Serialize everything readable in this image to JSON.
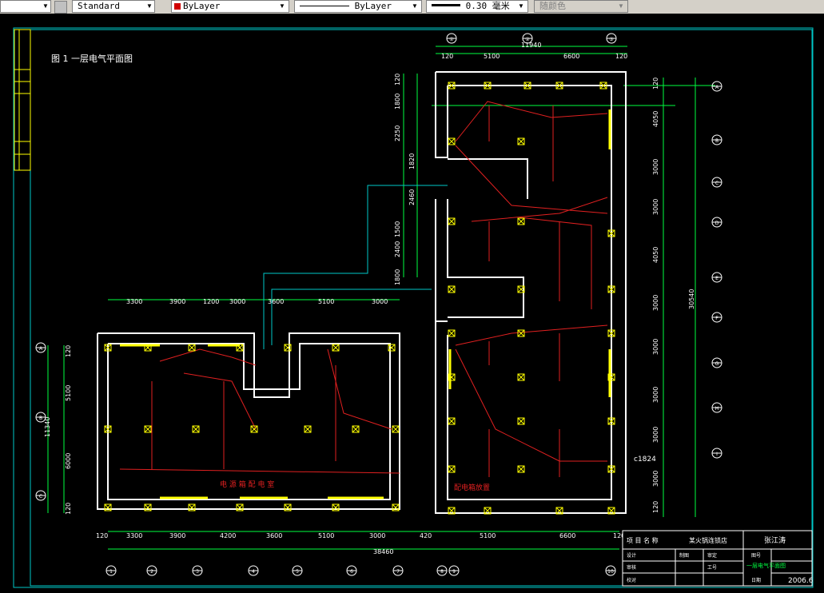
{
  "toolbar": {
    "text_style": "Standard",
    "layer": "ByLayer",
    "linetype": "ByLayer",
    "lineweight": "0.30 毫米",
    "plot_color": "随颜色",
    "layer_color": "#d00000"
  },
  "drawing": {
    "title": "图 1  一层电气平面图",
    "grid_top": [
      "①",
      "②",
      "③"
    ],
    "grid_right": [
      "A",
      "B",
      "C",
      "D",
      "E",
      "F",
      "G",
      "H",
      "I"
    ],
    "grid_left": [
      "A",
      "B",
      "C"
    ],
    "grid_bottom": [
      "1",
      "2",
      "3",
      "4",
      "5",
      "6",
      "7",
      "8",
      "9",
      "10"
    ],
    "dims_top_right": [
      "120",
      "5100",
      "6600",
      "120"
    ],
    "dim_top_total": "11940",
    "dims_mid": [
      "3300",
      "3900",
      "1200",
      "3000",
      "3600",
      "5100",
      "3000"
    ],
    "dims_bottom": [
      "120",
      "3300",
      "3900",
      "4200",
      "3600",
      "5100",
      "3000",
      "420",
      "5100",
      "6600",
      "120"
    ],
    "dim_bottom_total": "38460",
    "dims_left_vertical": [
      "120",
      "5100",
      "6000",
      "120"
    ],
    "dim_left_total": "11340",
    "dims_right_vertical": [
      "120",
      "4050",
      "3000",
      "3000",
      "4050",
      "3000",
      "3000",
      "3000",
      "3000",
      "3000",
      "120"
    ],
    "dim_right_total": "30540",
    "dims_inner_vertical": [
      "120",
      "1800",
      "2250",
      "1820",
      "2460",
      "1500",
      "2400",
      "1800"
    ],
    "label_ref": "c1824",
    "room_label_1": "电 源 箱 配 电 室",
    "room_label_2": "配电箱放置"
  },
  "title_block": {
    "project_label": "项 目 名 称",
    "project_value": "某火锅连锁店",
    "designer": "张江涛",
    "sheet_name": "一层电气平面图",
    "date": "2006.6",
    "labels": [
      "设计",
      "审核",
      "校对",
      "制图",
      "审定",
      "工号",
      "图号",
      "日期"
    ]
  },
  "colors": {
    "wall": "#ffffff",
    "wiring": "#e02020",
    "dimension": "#00ff40",
    "fixture": "#ffff00",
    "frame": "#00c8c8"
  }
}
